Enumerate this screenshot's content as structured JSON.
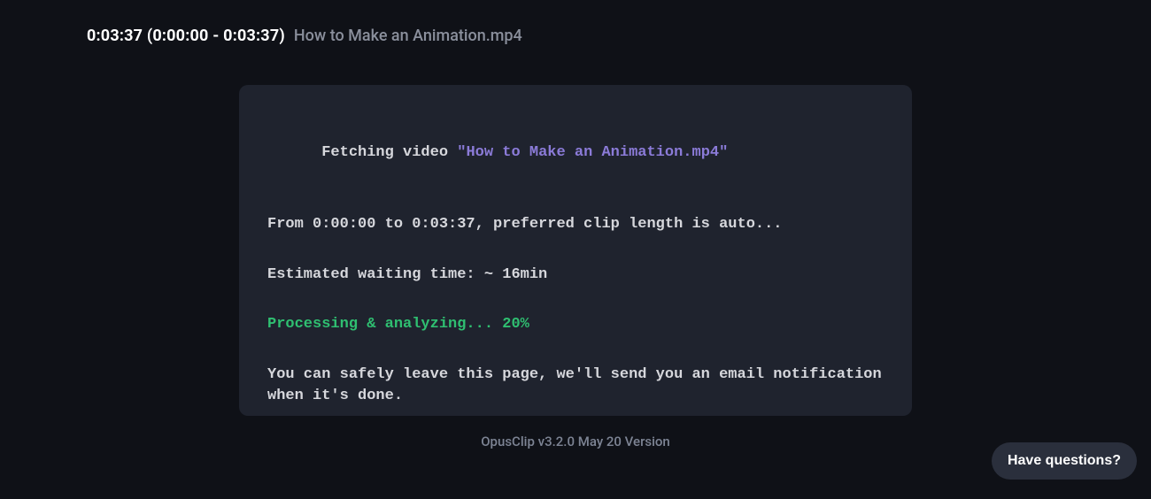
{
  "header": {
    "duration_range": "0:03:37 (0:00:00 - 0:03:37)",
    "filename": "How to Make an Animation.mp4"
  },
  "console": {
    "fetch_prefix": "Fetching video ",
    "fetch_filename": "\"How to Make an Animation.mp4\"",
    "range_line": "From 0:00:00 to 0:03:37, preferred clip length is auto...",
    "eta_line": "Estimated waiting time: ~ 16min",
    "progress_line": "Processing & analyzing... 20%",
    "notice_line": "You can safely leave this page, we'll send you an email notification when it's done."
  },
  "footer": {
    "version_text": "OpusClip v3.2.0 May 20 Version"
  },
  "help": {
    "label": "Have questions?"
  }
}
